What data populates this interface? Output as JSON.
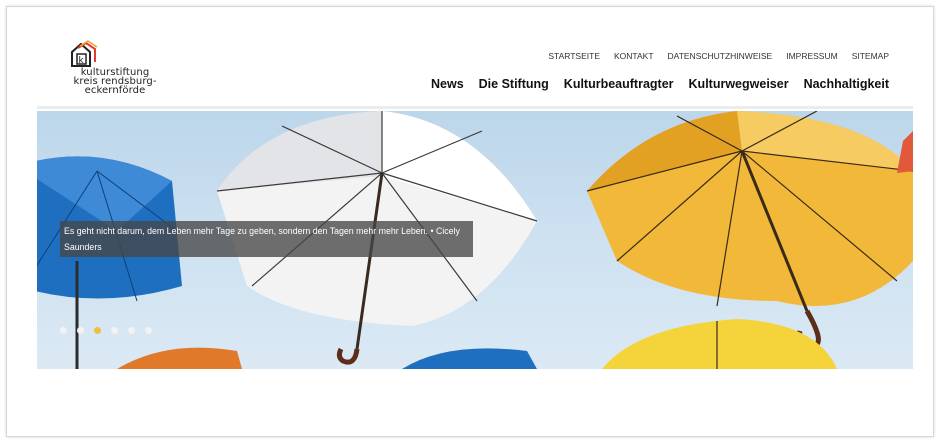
{
  "logo": {
    "line1": "kulturstiftung",
    "line2": "kreis rendsburg-",
    "line3": "eckernförde"
  },
  "top_nav": [
    "STARTSEITE",
    "KONTAKT",
    "DATENSCHUTZHINWEISE",
    "IMPRESSUM",
    "SITEMAP"
  ],
  "main_nav": [
    "News",
    "Die Stiftung",
    "Kulturbeauftragter",
    "Kulturwegweiser",
    "Nachhaltigkeit"
  ],
  "hero": {
    "quote": "Es geht nicht darum, dem Leben mehr Tage zu geben, sondern den Tagen mehr mehr Leben. • Cicely Saunders",
    "slides": 6,
    "active_slide": 3
  },
  "colors": {
    "accent_dot": "#f0c03a",
    "umbrella_blue": "#1f6fc0",
    "umbrella_white": "#f3f3f4",
    "umbrella_yellow": "#f2b83a",
    "umbrella_orange": "#e07a2a"
  }
}
